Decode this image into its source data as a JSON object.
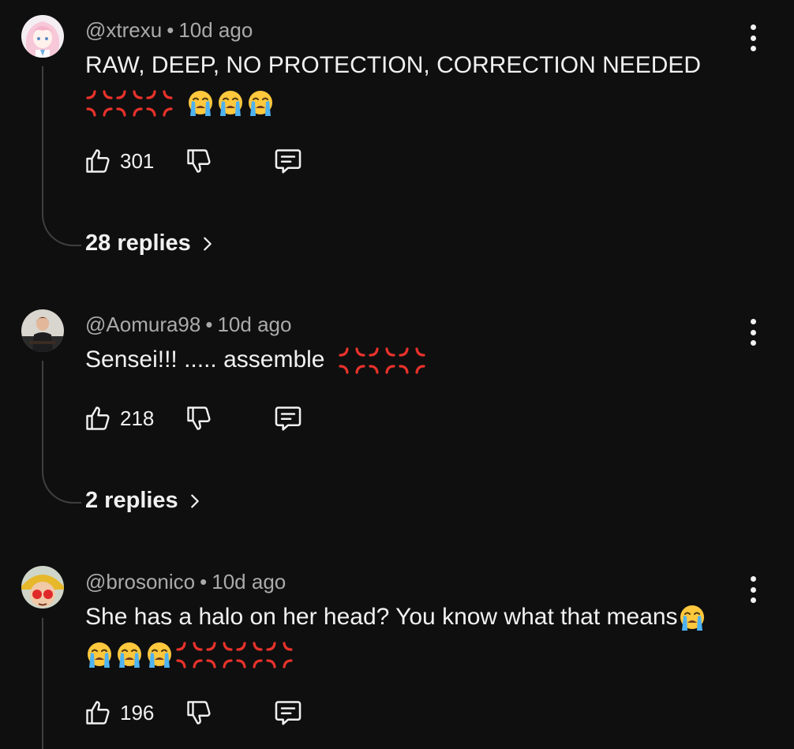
{
  "comments": [
    {
      "author": "@xtrexu",
      "separator": "•",
      "time": "10d ago",
      "line1": "RAW, DEEP, NO PROTECTION, CORRECTION NEEDED",
      "line2_emojis": [
        "anger",
        "anger",
        "anger",
        "gap",
        "sob",
        "sob",
        "sob"
      ],
      "likes": "301",
      "replies": "28 replies",
      "avatar_icon": "anime-girl-avatar"
    },
    {
      "author": "@Aomura98",
      "separator": "•",
      "time": "10d ago",
      "line1": "Sensei!!! ..... assemble",
      "line1_emojis": [
        "anger",
        "anger",
        "anger"
      ],
      "likes": "218",
      "replies": "2 replies",
      "avatar_icon": "person-photo-avatar"
    },
    {
      "author": "@brosonico",
      "separator": "•",
      "time": "10d ago",
      "line1": "She has a halo on her head? You know what that means",
      "line1_emojis": [
        "sob"
      ],
      "line2_emojis": [
        "sob",
        "sob",
        "sob",
        "anger",
        "anger",
        "anger",
        "anger"
      ],
      "likes": "196",
      "avatar_icon": "yellow-hat-avatar"
    }
  ],
  "icons": {
    "like": "thumbs-up-icon",
    "dislike": "thumbs-down-icon",
    "reply": "comment-icon",
    "more": "more-vert-icon",
    "chevron": "chevron-right-icon"
  },
  "colors": {
    "background": "#0f0f0f",
    "text": "#f1f1f1",
    "meta": "#aaaaaa",
    "thread": "#3f3f3f",
    "anger": "#e8322b",
    "sob_face": "#ffc83d",
    "sob_tears": "#4fb3f0"
  }
}
